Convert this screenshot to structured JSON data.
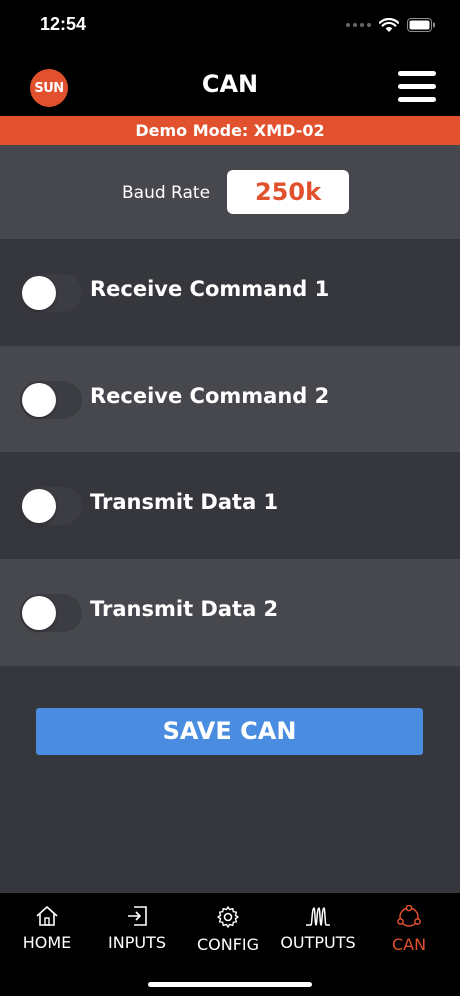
{
  "status_bar": {
    "time": "12:54"
  },
  "header": {
    "logo_text": "SUN",
    "title": "CAN"
  },
  "banner": {
    "text": "Demo Mode: XMD-02"
  },
  "baud": {
    "label": "Baud Rate",
    "value": "250k"
  },
  "toggles": [
    {
      "label": "Receive Command 1",
      "on": false
    },
    {
      "label": "Receive Command 2",
      "on": false
    },
    {
      "label": "Transmit Data 1",
      "on": false
    },
    {
      "label": "Transmit Data 2",
      "on": false
    }
  ],
  "save_button": {
    "label": "SAVE CAN"
  },
  "tabbar": {
    "tabs": [
      {
        "label": "HOME",
        "icon": "home-icon",
        "active": false
      },
      {
        "label": "INPUTS",
        "icon": "inputs-icon",
        "active": false
      },
      {
        "label": "CONFIG",
        "icon": "gear-icon",
        "active": false
      },
      {
        "label": "OUTPUTS",
        "icon": "outputs-icon",
        "active": false
      },
      {
        "label": "CAN",
        "icon": "can-network-icon",
        "active": true
      }
    ]
  },
  "colors": {
    "accent": "#e2512e",
    "button": "#4a8de0",
    "row_dark": "#36373d",
    "row_light": "#47484d"
  }
}
